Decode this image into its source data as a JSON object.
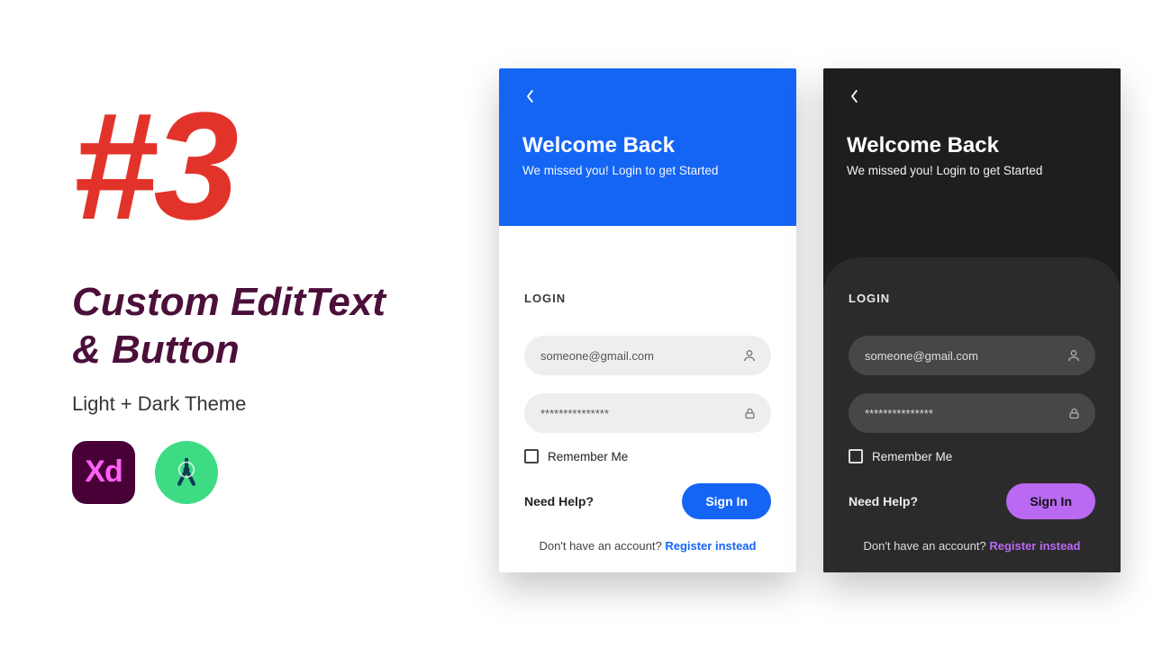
{
  "left": {
    "hash": "#3",
    "title_line1": "Custom EditText",
    "title_line2": "& Button",
    "subtitle": "Light + Dark Theme",
    "xd_label": "Xd"
  },
  "shared": {
    "welcome_title": "Welcome Back",
    "welcome_sub": "We missed you! Login to get Started",
    "login_label": "LOGIN",
    "email_placeholder": "someone@gmail.com",
    "password_placeholder": "***************",
    "remember_label": "Remember Me",
    "need_help": "Need Help?",
    "signin": "Sign In",
    "no_account": "Don't have an account? ",
    "register": "Register instead"
  },
  "colors": {
    "accent_light": "#1565f5",
    "accent_dark": "#b969f2",
    "dark_bg": "#1e1e1e",
    "dark_sheet": "#2b2b2b",
    "brand_red": "#e2332a",
    "brand_maroon": "#4c0f3a"
  }
}
